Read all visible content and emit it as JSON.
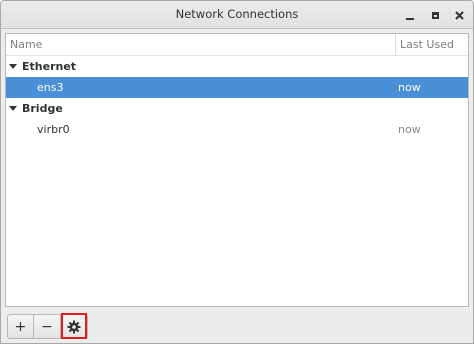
{
  "window": {
    "title": "Network Connections"
  },
  "columns": {
    "name": "Name",
    "last_used": "Last Used"
  },
  "groups": [
    {
      "label": "Ethernet",
      "connections": [
        {
          "name": "ens3",
          "last_used": "now",
          "selected": true
        }
      ]
    },
    {
      "label": "Bridge",
      "connections": [
        {
          "name": "virbr0",
          "last_used": "now",
          "selected": false
        }
      ]
    }
  ],
  "toolbar": {
    "add_label": "+",
    "remove_label": "−",
    "settings_icon": "gear-icon"
  },
  "annotation": {
    "highlight_color": "#e11d1d"
  },
  "colors": {
    "selection": "#4a90d9"
  }
}
